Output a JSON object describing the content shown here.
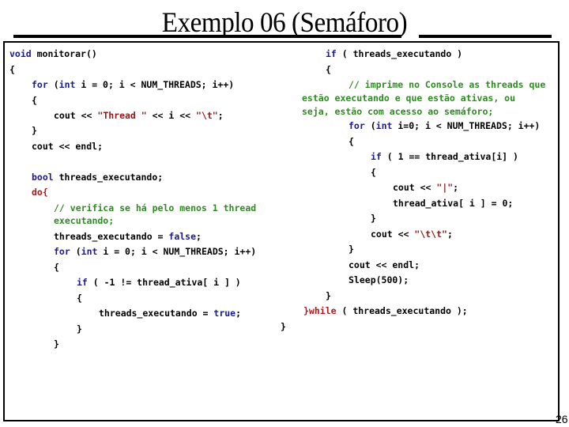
{
  "slide": {
    "title": "Exemplo 06 (Semáforo)",
    "page_number": "26"
  },
  "left_code": {
    "l1": {
      "kw": "void",
      "rest": " monitorar()"
    },
    "l2": "{",
    "l3": {
      "kw1": "for",
      "p1": " (",
      "kw2": "int",
      "rest": " i = 0; i < NUM_THREADS; i++)"
    },
    "l4": "{",
    "l5": {
      "pre": "cout << ",
      "s1": "\"Thread \"",
      "mid": " << i << ",
      "s2": "\"\\t\"",
      "end": ";"
    },
    "l6": "}",
    "l7": "cout << endl;",
    "l8": {
      "kw": "bool",
      "rest": " threads_executando;"
    },
    "l9": "do{",
    "l10": "// verifica se há pelo menos 1 thread",
    "l11": "executando;",
    "l12": {
      "pre": "threads_executando = ",
      "kw": "false",
      "end": ";"
    },
    "l13": {
      "kw1": "for",
      "p1": " (",
      "kw2": "int",
      "rest": " i = 0; i < NUM_THREADS; i++)"
    },
    "l14": "{",
    "l15": {
      "kw": "if",
      "rest": " ( -1 != thread_ativa[ i ] )"
    },
    "l16": "{",
    "l17": {
      "pre": "threads_executando = ",
      "kw": "true",
      "end": ";"
    },
    "l18": "}",
    "l19": "}"
  },
  "right_code": {
    "r1": {
      "kw": "if",
      "rest": " ( threads_executando )"
    },
    "r2": "{",
    "r3": "// imprime no Console as threads que",
    "r4": "estão executando e que estão ativas, ou",
    "r5": "seja, estão com acesso ao semáforo;",
    "r6": {
      "kw1": "for",
      "p1": " (",
      "kw2": "int",
      "rest": " i=0; i < NUM_THREADS; i++)"
    },
    "r7": "{",
    "r8": {
      "kw": "if",
      "rest": " ( 1 == thread_ativa[i] )"
    },
    "r9": "{",
    "r10": {
      "pre": "cout << ",
      "s": "\"|\"",
      "end": ";"
    },
    "r11": "thread_ativa[ i ] = 0;",
    "r12": "}",
    "r13": {
      "pre": "cout << ",
      "s": "\"\\t\\t\"",
      "end": ";"
    },
    "r14": "}",
    "r15": "cout << endl;",
    "r16": "Sleep(500);",
    "r17": "}",
    "r18": {
      "kw": "}while",
      "rest": " ( threads_executando );"
    },
    "r19": "}"
  }
}
